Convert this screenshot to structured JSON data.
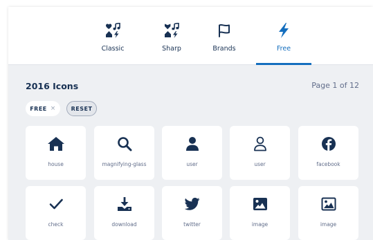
{
  "tabs": [
    {
      "label": "Classic",
      "icon": "classic-family-icon",
      "active": false
    },
    {
      "label": "Sharp",
      "icon": "sharp-family-icon",
      "active": false
    },
    {
      "label": "Brands",
      "icon": "flag-icon",
      "active": false
    },
    {
      "label": "Free",
      "icon": "bolt-icon",
      "active": true
    }
  ],
  "results": {
    "title": "2016 Icons",
    "page": "Page 1 of 12"
  },
  "filters": {
    "free": "FREE",
    "free_remove": "×",
    "reset": "RESET"
  },
  "icons": [
    {
      "name": "house",
      "icon": "house-icon"
    },
    {
      "name": "magnifying-glass",
      "icon": "magnifying-glass-icon"
    },
    {
      "name": "user",
      "icon": "user-solid-icon"
    },
    {
      "name": "user",
      "icon": "user-outline-icon"
    },
    {
      "name": "facebook",
      "icon": "facebook-icon"
    },
    {
      "name": "check",
      "icon": "check-icon"
    },
    {
      "name": "download",
      "icon": "download-icon"
    },
    {
      "name": "twitter",
      "icon": "twitter-icon"
    },
    {
      "name": "image",
      "icon": "image-icon"
    },
    {
      "name": "image",
      "icon": "image-outline-icon"
    }
  ],
  "colors": {
    "ink": "#183153",
    "accent": "#146ebe",
    "muted": "#616d8a",
    "background": "#eef0f3"
  }
}
